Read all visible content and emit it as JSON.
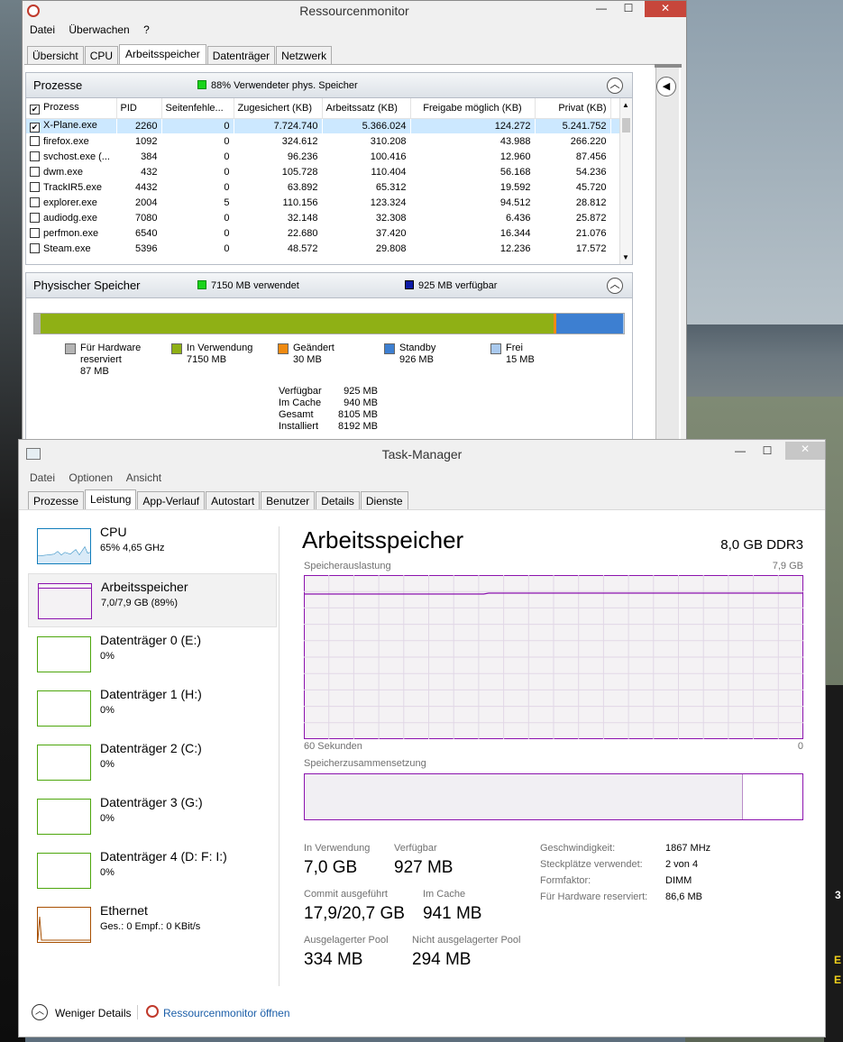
{
  "rm": {
    "title": "Ressourcenmonitor",
    "menu": [
      "Datei",
      "Überwachen",
      "?"
    ],
    "tabs": [
      "Übersicht",
      "CPU",
      "Arbeitsspeicher",
      "Datenträger",
      "Netzwerk"
    ],
    "active_tab": "Arbeitsspeicher",
    "processes": {
      "header": "Prozesse",
      "summary": "88% Verwendeter phys. Speicher",
      "columns": [
        "Prozess",
        "PID",
        "Seitenfehle...",
        "Zugesichert (KB)",
        "Arbeitssatz (KB)",
        "Freigabe möglich (KB)",
        "Privat (KB)"
      ],
      "rows": [
        {
          "name": "X-Plane.exe",
          "pid": "2260",
          "faults": "0",
          "commit": "7.724.740",
          "ws": "5.366.024",
          "share": "124.272",
          "priv": "5.241.752",
          "checked": true
        },
        {
          "name": "firefox.exe",
          "pid": "1092",
          "faults": "0",
          "commit": "324.612",
          "ws": "310.208",
          "share": "43.988",
          "priv": "266.220",
          "checked": false
        },
        {
          "name": "svchost.exe (...",
          "pid": "384",
          "faults": "0",
          "commit": "96.236",
          "ws": "100.416",
          "share": "12.960",
          "priv": "87.456",
          "checked": false
        },
        {
          "name": "dwm.exe",
          "pid": "432",
          "faults": "0",
          "commit": "105.728",
          "ws": "110.404",
          "share": "56.168",
          "priv": "54.236",
          "checked": false
        },
        {
          "name": "TrackIR5.exe",
          "pid": "4432",
          "faults": "0",
          "commit": "63.892",
          "ws": "65.312",
          "share": "19.592",
          "priv": "45.720",
          "checked": false
        },
        {
          "name": "explorer.exe",
          "pid": "2004",
          "faults": "5",
          "commit": "110.156",
          "ws": "123.324",
          "share": "94.512",
          "priv": "28.812",
          "checked": false
        },
        {
          "name": "audiodg.exe",
          "pid": "7080",
          "faults": "0",
          "commit": "32.148",
          "ws": "32.308",
          "share": "6.436",
          "priv": "25.872",
          "checked": false
        },
        {
          "name": "perfmon.exe",
          "pid": "6540",
          "faults": "0",
          "commit": "22.680",
          "ws": "37.420",
          "share": "16.344",
          "priv": "21.076",
          "checked": false
        },
        {
          "name": "Steam.exe",
          "pid": "5396",
          "faults": "0",
          "commit": "48.572",
          "ws": "29.808",
          "share": "12.236",
          "priv": "17.572",
          "checked": false
        }
      ]
    },
    "physical": {
      "header": "Physischer Speicher",
      "used": "7150 MB verwendet",
      "available": "925 MB verfügbar",
      "bar_fractions": {
        "reserved": 0.011,
        "in_use": 0.873,
        "modified": 0.004,
        "standby": 0.113,
        "free": 0.002
      },
      "legend": [
        {
          "name": "Für Hardware reserviert",
          "value": "87 MB",
          "color": "#b4b4b4"
        },
        {
          "name": "In Verwendung",
          "value": "7150 MB",
          "color": "#8fb015"
        },
        {
          "name": "Geändert",
          "value": "30 MB",
          "color": "#ef8a11"
        },
        {
          "name": "Standby",
          "value": "926 MB",
          "color": "#3d7fd1"
        },
        {
          "name": "Frei",
          "value": "15 MB",
          "color": "#a9c9ee"
        }
      ],
      "stats": [
        {
          "k": "Verfügbar",
          "v": "925 MB"
        },
        {
          "k": "Im Cache",
          "v": "940 MB"
        },
        {
          "k": "Gesamt",
          "v": "8105 MB"
        },
        {
          "k": "Installiert",
          "v": "8192 MB"
        }
      ]
    }
  },
  "tm": {
    "title": "Task-Manager",
    "menu": [
      "Datei",
      "Optionen",
      "Ansicht"
    ],
    "tabs": [
      "Prozesse",
      "Leistung",
      "App-Verlauf",
      "Autostart",
      "Benutzer",
      "Details",
      "Dienste"
    ],
    "active_tab": "Leistung",
    "sidebar": [
      {
        "name": "CPU",
        "sub": "65% 4,65 GHz",
        "color": "#117dbb"
      },
      {
        "name": "Arbeitsspeicher",
        "sub": "7,0/7,9 GB (89%)",
        "color": "#8b12ae"
      },
      {
        "name": "Datenträger 0 (E:)",
        "sub": "0%",
        "color": "#4da60c"
      },
      {
        "name": "Datenträger 1 (H:)",
        "sub": "0%",
        "color": "#4da60c"
      },
      {
        "name": "Datenträger 2 (C:)",
        "sub": "0%",
        "color": "#4da60c"
      },
      {
        "name": "Datenträger 3 (G:)",
        "sub": "0%",
        "color": "#4da60c"
      },
      {
        "name": "Datenträger 4 (D: F: I:)",
        "sub": "0%",
        "color": "#4da60c"
      },
      {
        "name": "Ethernet",
        "sub": "Ges.: 0 Empf.: 0 KBit/s",
        "color": "#a74f01"
      }
    ],
    "main": {
      "title": "Arbeitsspeicher",
      "spec": "8,0 GB DDR3",
      "graph_label": "Speicherauslastung",
      "graph_max": "7,9 GB",
      "graph_time": "60 Sekunden",
      "graph_min": "0",
      "usage_fraction": 0.89,
      "composition_label": "Speicherzusammensetzung",
      "composition_in_use_fraction": 0.88,
      "stats": {
        "in_use_label": "In Verwendung",
        "in_use": "7,0 GB",
        "available_label": "Verfügbar",
        "available": "927 MB",
        "commit_label": "Commit ausgeführt",
        "commit": "17,9/20,7 GB",
        "cache_label": "Im Cache",
        "cache": "941 MB",
        "paged_label": "Ausgelagerter Pool",
        "paged": "334 MB",
        "nonpaged_label": "Nicht ausgelagerter Pool",
        "nonpaged": "294 MB"
      },
      "details": [
        {
          "k": "Geschwindigkeit:",
          "v": "1867 MHz"
        },
        {
          "k": "Steckplätze verwendet:",
          "v": "2 von 4"
        },
        {
          "k": "Formfaktor:",
          "v": "DIMM"
        },
        {
          "k": "Für Hardware reserviert:",
          "v": "86,6 MB"
        }
      ]
    },
    "footer": {
      "less": "Weniger Details",
      "open_rm": "Ressourcenmonitor öffnen"
    }
  },
  "background": {
    "hud_1": "E",
    "hud_2": "E",
    "hud_3": "3"
  }
}
